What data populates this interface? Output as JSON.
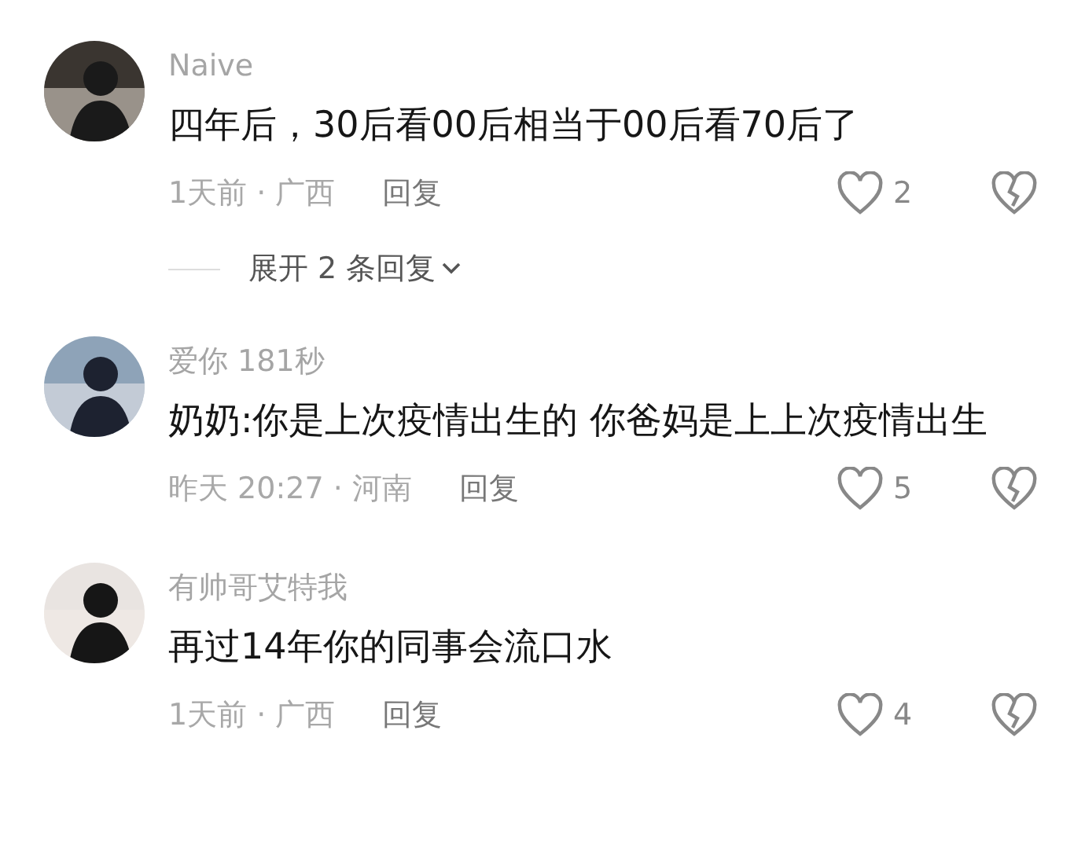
{
  "comments": [
    {
      "name": "Naive",
      "text": "四年后，30后看00后相当于00后看70后了",
      "meta": "1天前 · 广西",
      "reply": "回复",
      "likes": "2",
      "expand": "展开 2 条回复"
    },
    {
      "name": "爱你 181秒",
      "text": "奶奶:你是上次疫情出生的 你爸妈是上上次疫情出生",
      "meta": "昨天 20:27 · 河南",
      "reply": "回复",
      "likes": "5"
    },
    {
      "name": "有帅哥艾特我",
      "text": "再过14年你的同事会流口水",
      "meta": "1天前 · 广西",
      "reply": "回复",
      "likes": "4"
    }
  ]
}
